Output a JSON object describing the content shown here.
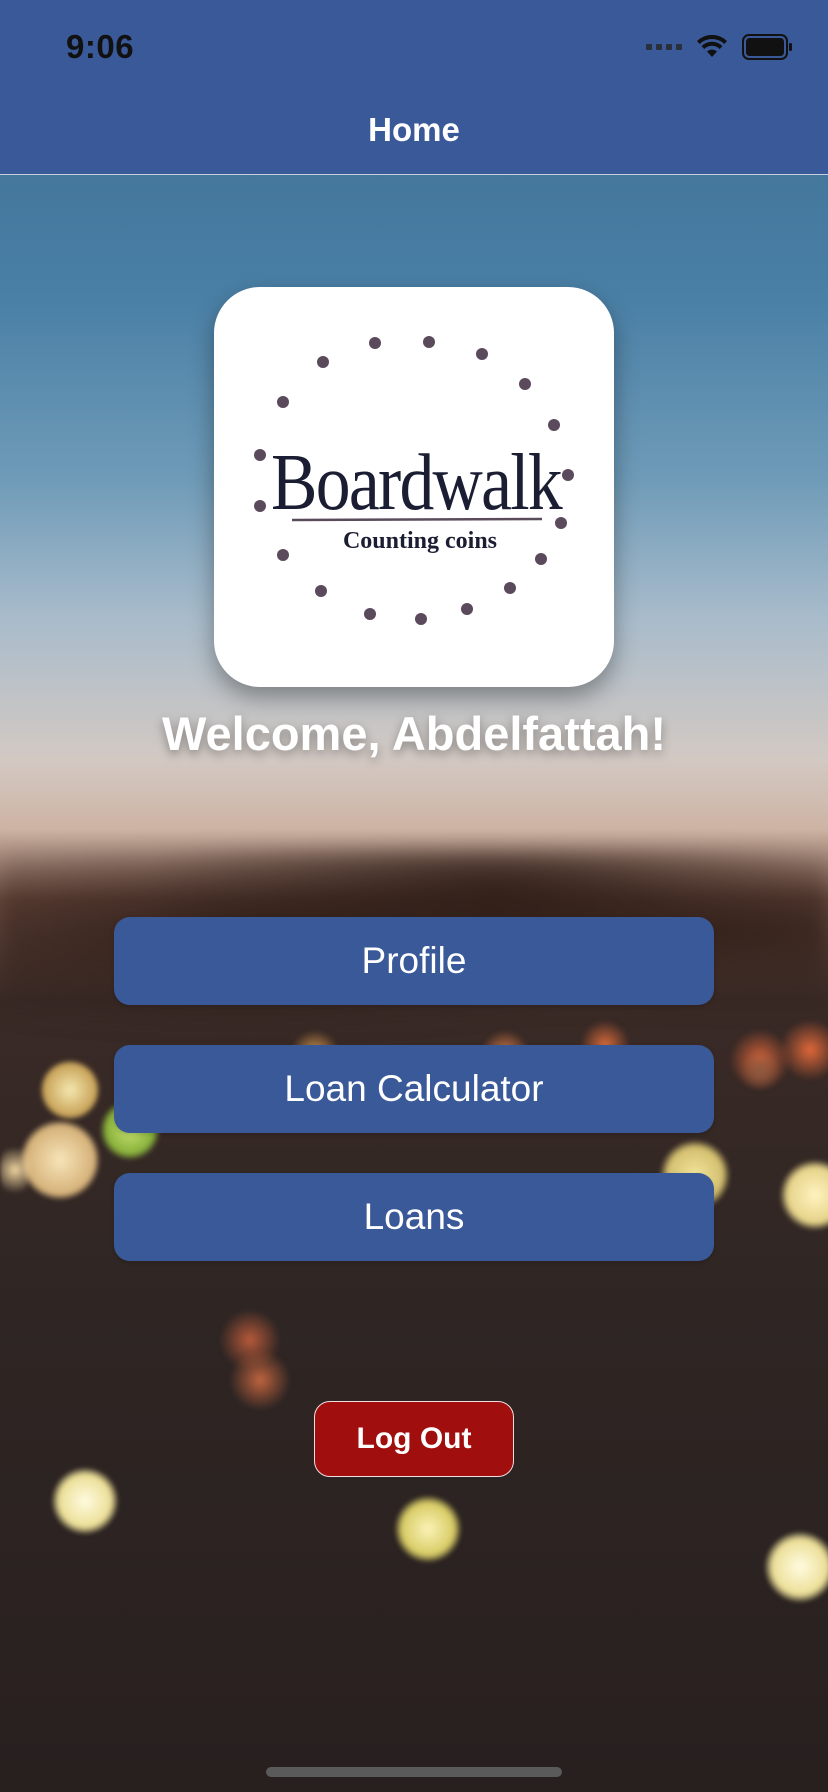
{
  "status_bar": {
    "time": "9:06"
  },
  "nav": {
    "title": "Home"
  },
  "logo": {
    "name": "Boardwalk",
    "tagline": "Counting coins"
  },
  "welcome_text": "Welcome, Abdelfattah!",
  "menu": {
    "profile_label": "Profile",
    "loan_calculator_label": "Loan Calculator",
    "loans_label": "Loans"
  },
  "logout_label": "Log Out",
  "colors": {
    "nav_bar": "#3a5998",
    "button": "#3a5998",
    "logout": "#a00e0e",
    "logo_text": "#1b1d33",
    "logo_dots": "#5b4a5c"
  }
}
